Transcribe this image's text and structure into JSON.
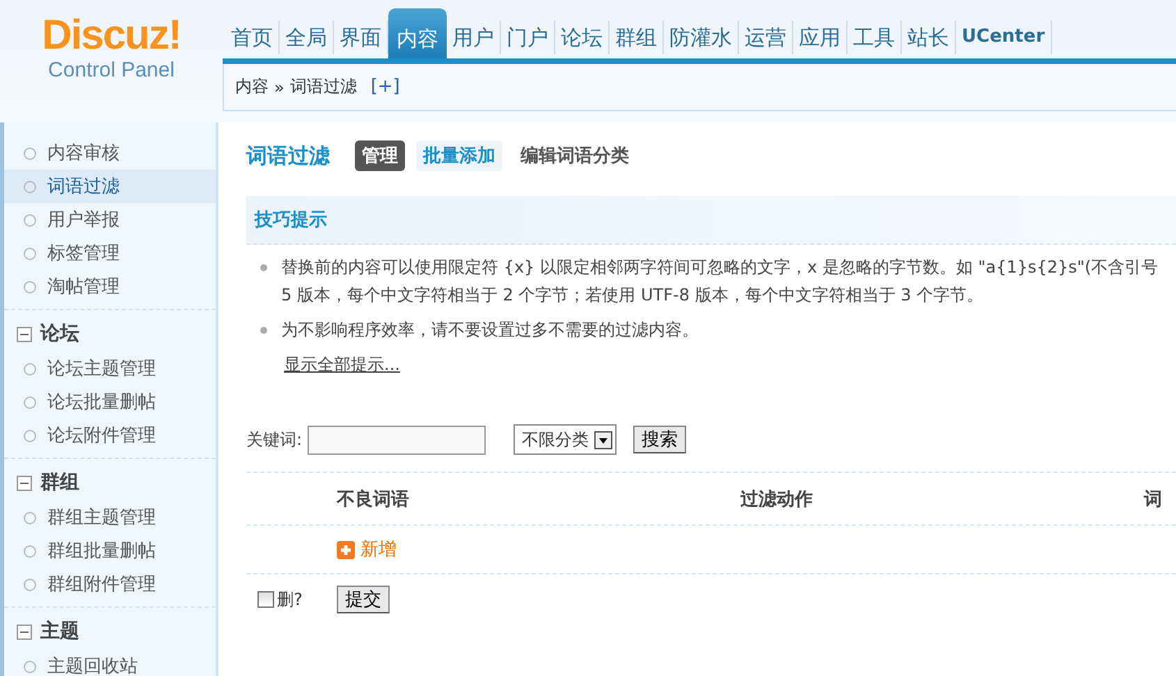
{
  "logo": {
    "name": "Discuz!",
    "subtitle": "Control Panel"
  },
  "nav_tabs": [
    {
      "label": "首页",
      "selected": false
    },
    {
      "label": "全局",
      "selected": false
    },
    {
      "label": "界面",
      "selected": false
    },
    {
      "label": "内容",
      "selected": true
    },
    {
      "label": "用户",
      "selected": false
    },
    {
      "label": "门户",
      "selected": false
    },
    {
      "label": "论坛",
      "selected": false
    },
    {
      "label": "群组",
      "selected": false
    },
    {
      "label": "防灌水",
      "selected": false
    },
    {
      "label": "运营",
      "selected": false
    },
    {
      "label": "应用",
      "selected": false
    },
    {
      "label": "工具",
      "selected": false
    },
    {
      "label": "站长",
      "selected": false
    },
    {
      "label": "UCenter",
      "selected": false
    }
  ],
  "breadcrumb": {
    "section": "内容",
    "separator": "»",
    "current": "词语过滤",
    "add": "[+]"
  },
  "sidebar": {
    "groups": [
      {
        "items": [
          {
            "label": "内容审核",
            "selected": false
          },
          {
            "label": "词语过滤",
            "selected": true
          },
          {
            "label": "用户举报",
            "selected": false
          },
          {
            "label": "标签管理",
            "selected": false
          },
          {
            "label": "淘帖管理",
            "selected": false
          }
        ]
      },
      {
        "title": "论坛",
        "expanded": true,
        "items": [
          {
            "label": "论坛主题管理",
            "selected": false
          },
          {
            "label": "论坛批量删帖",
            "selected": false
          },
          {
            "label": "论坛附件管理",
            "selected": false
          }
        ]
      },
      {
        "title": "群组",
        "expanded": true,
        "items": [
          {
            "label": "群组主题管理",
            "selected": false
          },
          {
            "label": "群组批量删帖",
            "selected": false
          },
          {
            "label": "群组附件管理",
            "selected": false
          }
        ]
      },
      {
        "title": "主题",
        "expanded": true,
        "items": [
          {
            "label": "主题回收站",
            "selected": false
          }
        ]
      }
    ]
  },
  "page_title": "词语过滤",
  "sub_tabs": [
    {
      "label": "管理",
      "kind": "tab",
      "selected": true
    },
    {
      "label": "批量添加",
      "kind": "tab",
      "selected": false
    },
    {
      "label": "编辑词语分类",
      "kind": "plain",
      "selected": false
    }
  ],
  "tips": {
    "title": "技巧提示",
    "items": [
      {
        "lines": [
          "替换前的内容可以使用限定符 {x} 以限定相邻两字符间可忽略的文字，x 是忽略的字节数。如 \"a{1}s{2}s\"(不含引号",
          "5 版本，每个中文字符相当于 2 个字节；若使用 UTF-8 版本，每个中文字符相当于 3 个字节。"
        ]
      },
      {
        "lines": [
          "为不影响程序效率，请不要设置过多不需要的过滤内容。"
        ]
      }
    ],
    "link": "显示全部提示..."
  },
  "search": {
    "label": "关键词:",
    "category": "不限分类",
    "button": "搜索"
  },
  "table": {
    "columns": [
      "不良词语",
      "过滤动作",
      "词"
    ],
    "add_label": "新增"
  },
  "footer": {
    "delete": {
      "label": "删?",
      "checked": false
    },
    "submit": "提交"
  }
}
